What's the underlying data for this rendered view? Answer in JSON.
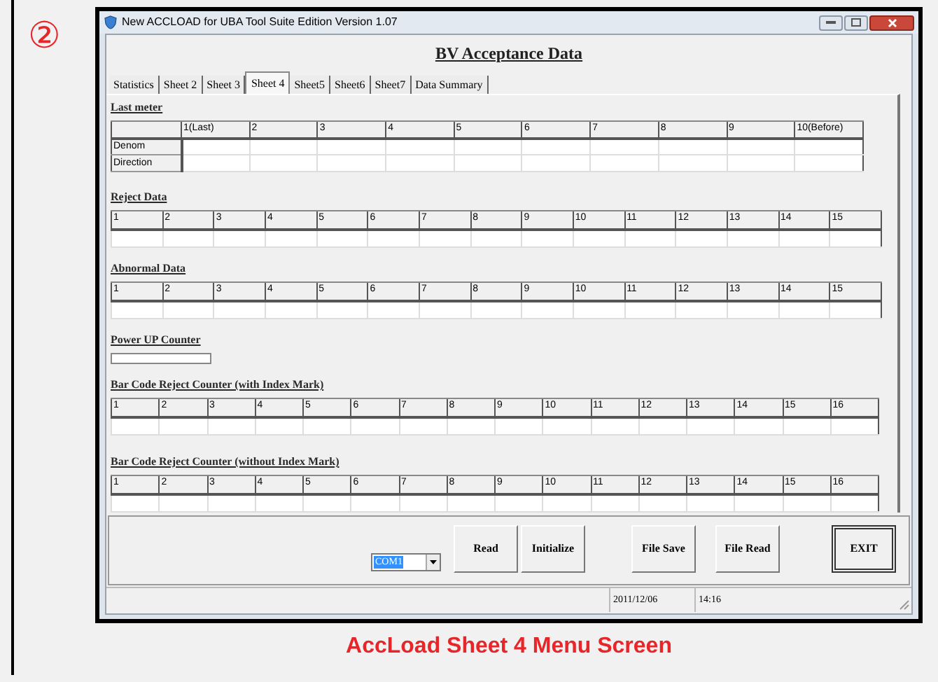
{
  "step_marker": "②",
  "window": {
    "title": "New ACCLOAD for UBA Tool Suite Edition Version 1.07"
  },
  "heading": "BV Acceptance Data",
  "tabs": [
    {
      "label": "Statistics",
      "selected": false
    },
    {
      "label": "Sheet 2",
      "selected": false
    },
    {
      "label": "Sheet 3",
      "selected": false
    },
    {
      "label": "Sheet 4",
      "selected": true
    },
    {
      "label": "Sheet5",
      "selected": false
    },
    {
      "label": "Sheet6",
      "selected": false
    },
    {
      "label": "Sheet7",
      "selected": false
    },
    {
      "label": "Data Summary",
      "selected": false
    }
  ],
  "sections": [
    {
      "kind": "grid",
      "label": "Last meter",
      "columns": [
        "1(Last)",
        "2",
        "3",
        "4",
        "5",
        "6",
        "7",
        "8",
        "9",
        "10(Before)"
      ],
      "rows": [
        "Denom",
        "Direction"
      ]
    },
    {
      "kind": "strip",
      "label": "Reject Data",
      "columns": [
        "1",
        "2",
        "3",
        "4",
        "5",
        "6",
        "7",
        "8",
        "9",
        "10",
        "11",
        "12",
        "13",
        "14",
        "15"
      ]
    },
    {
      "kind": "strip",
      "label": "Abnormal Data",
      "columns": [
        "1",
        "2",
        "3",
        "4",
        "5",
        "6",
        "7",
        "8",
        "9",
        "10",
        "11",
        "12",
        "13",
        "14",
        "15"
      ]
    },
    {
      "kind": "counter",
      "label": "Power UP Counter"
    },
    {
      "kind": "strip",
      "label": "Bar Code Reject Counter (with Index Mark)",
      "columns": [
        "1",
        "2",
        "3",
        "4",
        "5",
        "6",
        "7",
        "8",
        "9",
        "10",
        "11",
        "12",
        "13",
        "14",
        "15",
        "16"
      ]
    },
    {
      "kind": "strip",
      "label": "Bar Code Reject Counter (without Index Mark)",
      "columns": [
        "1",
        "2",
        "3",
        "4",
        "5",
        "6",
        "7",
        "8",
        "9",
        "10",
        "11",
        "12",
        "13",
        "14",
        "15",
        "16"
      ]
    }
  ],
  "port": {
    "value": "COM1",
    "selected": true
  },
  "buttons": [
    {
      "label": "Read",
      "default": false
    },
    {
      "label": "Initialize",
      "default": false
    },
    {
      "label": "File Save",
      "default": false
    },
    {
      "label": "File Read",
      "default": false
    },
    {
      "label": "EXIT",
      "default": true
    }
  ],
  "status_bar": {
    "date": "2011/12/06",
    "time": "14:16"
  },
  "caption": "AccLoad Sheet 4 Menu Screen"
}
